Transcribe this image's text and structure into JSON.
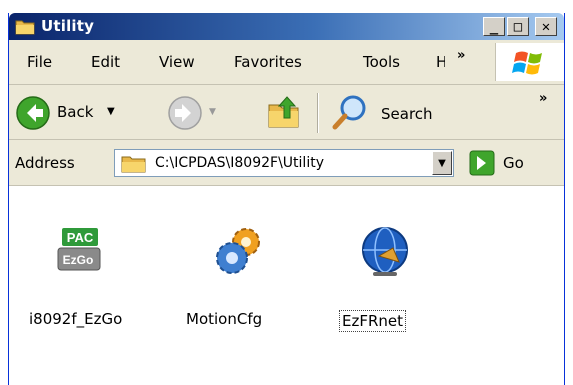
{
  "window": {
    "title": "Utility"
  },
  "caption_buttons": {
    "minimize": "_",
    "maximize": "□",
    "close": "✕"
  },
  "menu": {
    "items": [
      "File",
      "Edit",
      "View",
      "Favorites",
      "Tools",
      "H"
    ],
    "overflow": "»"
  },
  "toolbar": {
    "back_label": "Back",
    "search_label": "Search",
    "overflow": "»"
  },
  "address": {
    "label": "Address",
    "value": "C:\\ICPDAS\\I8092F\\Utility",
    "go_label": "Go"
  },
  "files": [
    {
      "label": "i8092f_EzGo",
      "icon": "pac-ezgo-icon",
      "logo_top": "PAC",
      "logo_bottom": "EzGo"
    },
    {
      "label": "MotionCfg",
      "icon": "gears-icon"
    },
    {
      "label": "EzFRnet",
      "icon": "globe-icon"
    }
  ],
  "colors": {
    "titlebar": "#0a246a",
    "chrome": "#ece9d8",
    "accent_green": "#3fa52c"
  }
}
